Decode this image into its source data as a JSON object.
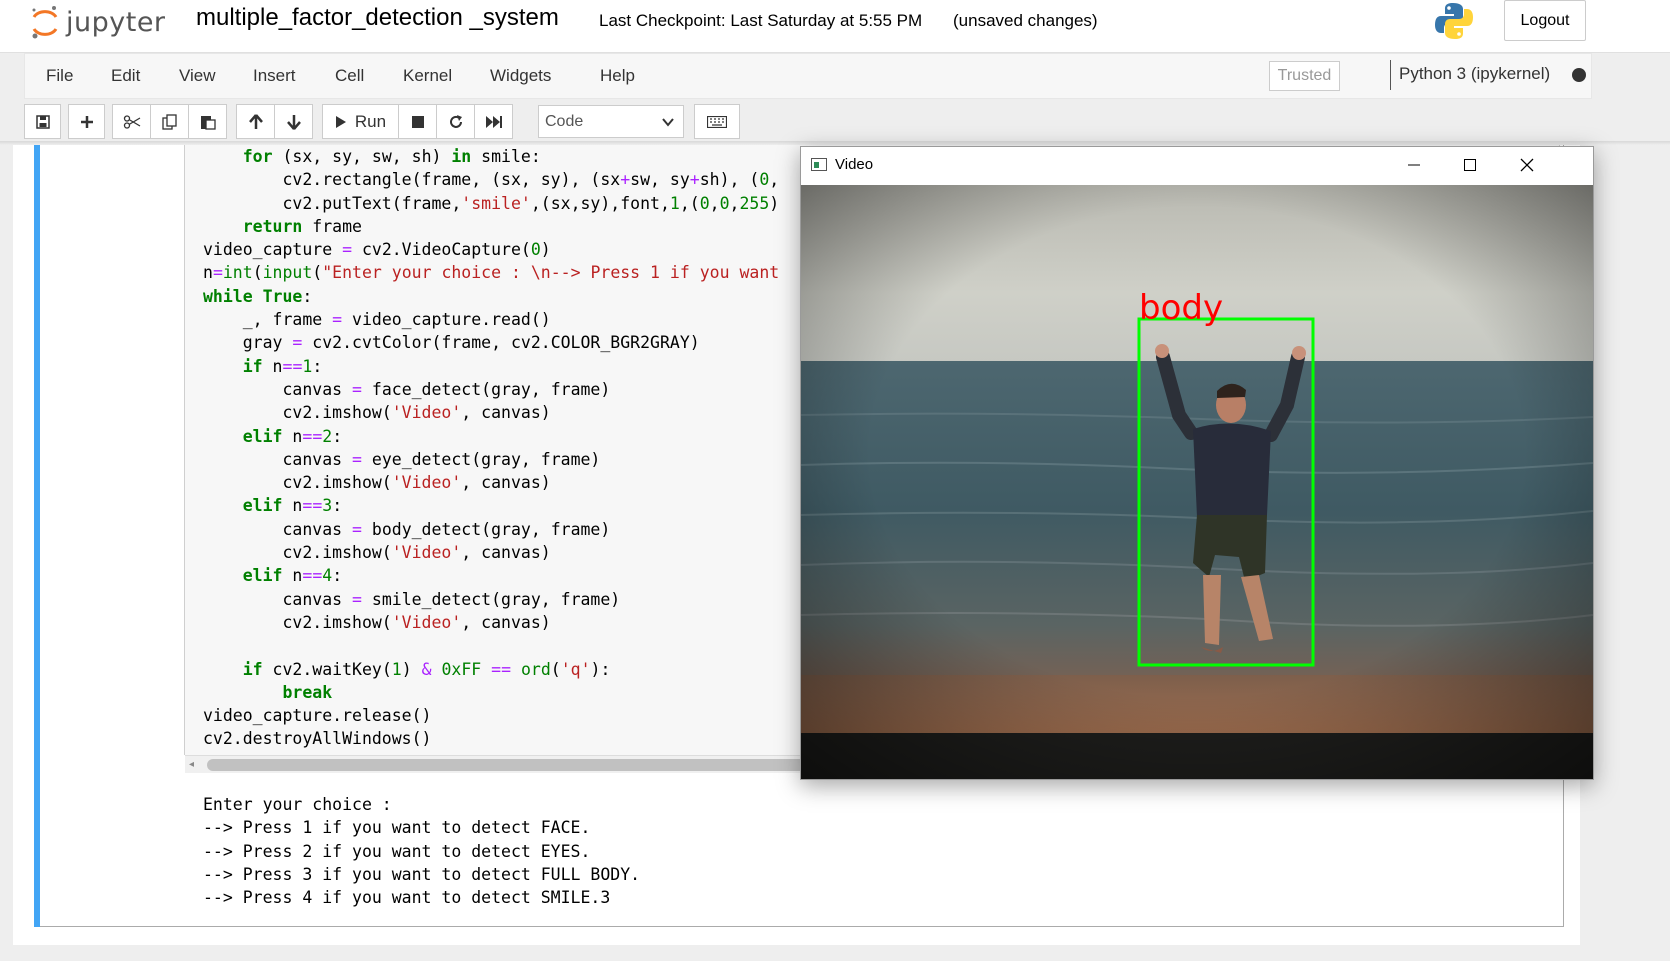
{
  "header": {
    "logo_text": "jupyter",
    "notebook_title": "multiple_factor_detection _system",
    "checkpoint": "Last Checkpoint: Last Saturday at 5:55 PM",
    "unsaved": "(unsaved changes)",
    "logout_label": "Logout"
  },
  "menubar": {
    "items": [
      "File",
      "Edit",
      "View",
      "Insert",
      "Cell",
      "Kernel",
      "Widgets",
      "Help"
    ],
    "trusted": "Trusted",
    "kernel_name": "Python 3 (ipykernel)"
  },
  "toolbar": {
    "run_label": "Run",
    "cell_type": "Code"
  },
  "code_lines": [
    "    for (sx, sy, sw, sh) in smile:",
    "        cv2.rectangle(frame, (sx, sy), (sx+sw, sy+sh), (0,",
    "        cv2.putText(frame,'smile',(sx,sy),font,1,(0,0,255)",
    "    return frame",
    "video_capture = cv2.VideoCapture(0)",
    "n=int(input(\"Enter your choice : \\n--> Press 1 if you want",
    "while True:",
    "    _, frame = video_capture.read()",
    "    gray = cv2.cvtColor(frame, cv2.COLOR_BGR2GRAY)",
    "    if n==1:",
    "        canvas = face_detect(gray, frame)",
    "        cv2.imshow('Video', canvas)",
    "    elif n==2:",
    "        canvas = eye_detect(gray, frame)",
    "        cv2.imshow('Video', canvas)",
    "    elif n==3:",
    "        canvas = body_detect(gray, frame)",
    "        cv2.imshow('Video', canvas)",
    "    elif n==4:",
    "        canvas = smile_detect(gray, frame)",
    "        cv2.imshow('Video', canvas)",
    "",
    "    if cv2.waitKey(1) & 0xFF == ord('q'):",
    "        break",
    "video_capture.release()",
    "cv2.destroyAllWindows()"
  ],
  "output_lines": [
    "Enter your choice :",
    "--> Press 1 if you want to detect FACE.",
    "--> Press 2 if you want to detect EYES.",
    "--> Press 3 if you want to detect FULL BODY.",
    "--> Press 4 if you want to detect SMILE.3"
  ],
  "video_window": {
    "title": "Video",
    "detection_label": "body",
    "box_color": "#00ff00",
    "label_color": "#ff0000"
  },
  "colors": {
    "accent_cell": "#42a5f5",
    "keyword": "#008000",
    "string": "#ba2121"
  }
}
